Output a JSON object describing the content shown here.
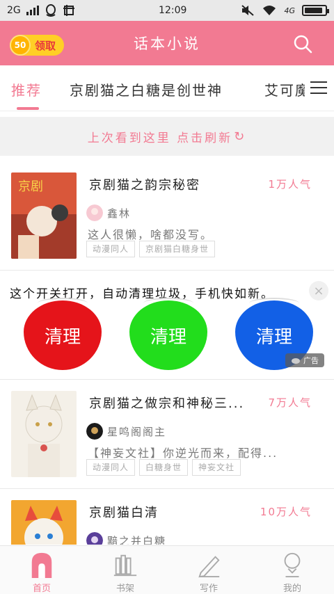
{
  "status": {
    "network": "2G",
    "time": "12:09",
    "signal_right": "4G",
    "battery_level": 0.9
  },
  "header": {
    "coin_value": "50",
    "coin_label": "领取",
    "title": "话本小说",
    "accent_color": "#f27a92"
  },
  "tabs": [
    {
      "label": "推荐",
      "active": true
    },
    {
      "label": "京剧猫之白糖是创世神",
      "active": false
    },
    {
      "label": "艾可魔",
      "active": false
    }
  ],
  "resume": {
    "text": "上次看到这里 点击刷新"
  },
  "books": [
    {
      "title": "京剧猫之韵宗秘密",
      "popularity": "1万人气",
      "author": "鑫林",
      "description": "这人很懒，啥都没写。",
      "tags": [
        "动漫同人",
        "京剧猫白糖身世"
      ]
    },
    {
      "title": "京剧猫之做宗和神秘三...",
      "popularity": "7万人气",
      "author": "星鸣阁阁主",
      "description": "【神妄文社】你逆光而来，配得...",
      "tags": [
        "动漫同人",
        "白糖身世",
        "神妄文社"
      ]
    },
    {
      "title": "京剧猫白清",
      "popularity": "10万人气",
      "author": "黯之并白糖",
      "description": "",
      "tags": []
    }
  ],
  "ad": {
    "text": "这个开关打开，自动清理垃圾，手机快如新。",
    "buttons": [
      {
        "label": "清理",
        "color": "#e5141a"
      },
      {
        "label": "清理",
        "color": "#22dd1c"
      },
      {
        "label": "清理",
        "color": "#1260e6"
      }
    ],
    "badge": "广告"
  },
  "bottom_nav": [
    {
      "label": "首页",
      "icon": "home-icon",
      "active": true
    },
    {
      "label": "书架",
      "icon": "bookshelf-icon",
      "active": false
    },
    {
      "label": "写作",
      "icon": "pen-icon",
      "active": false
    },
    {
      "label": "我的",
      "icon": "profile-icon",
      "active": false
    }
  ]
}
